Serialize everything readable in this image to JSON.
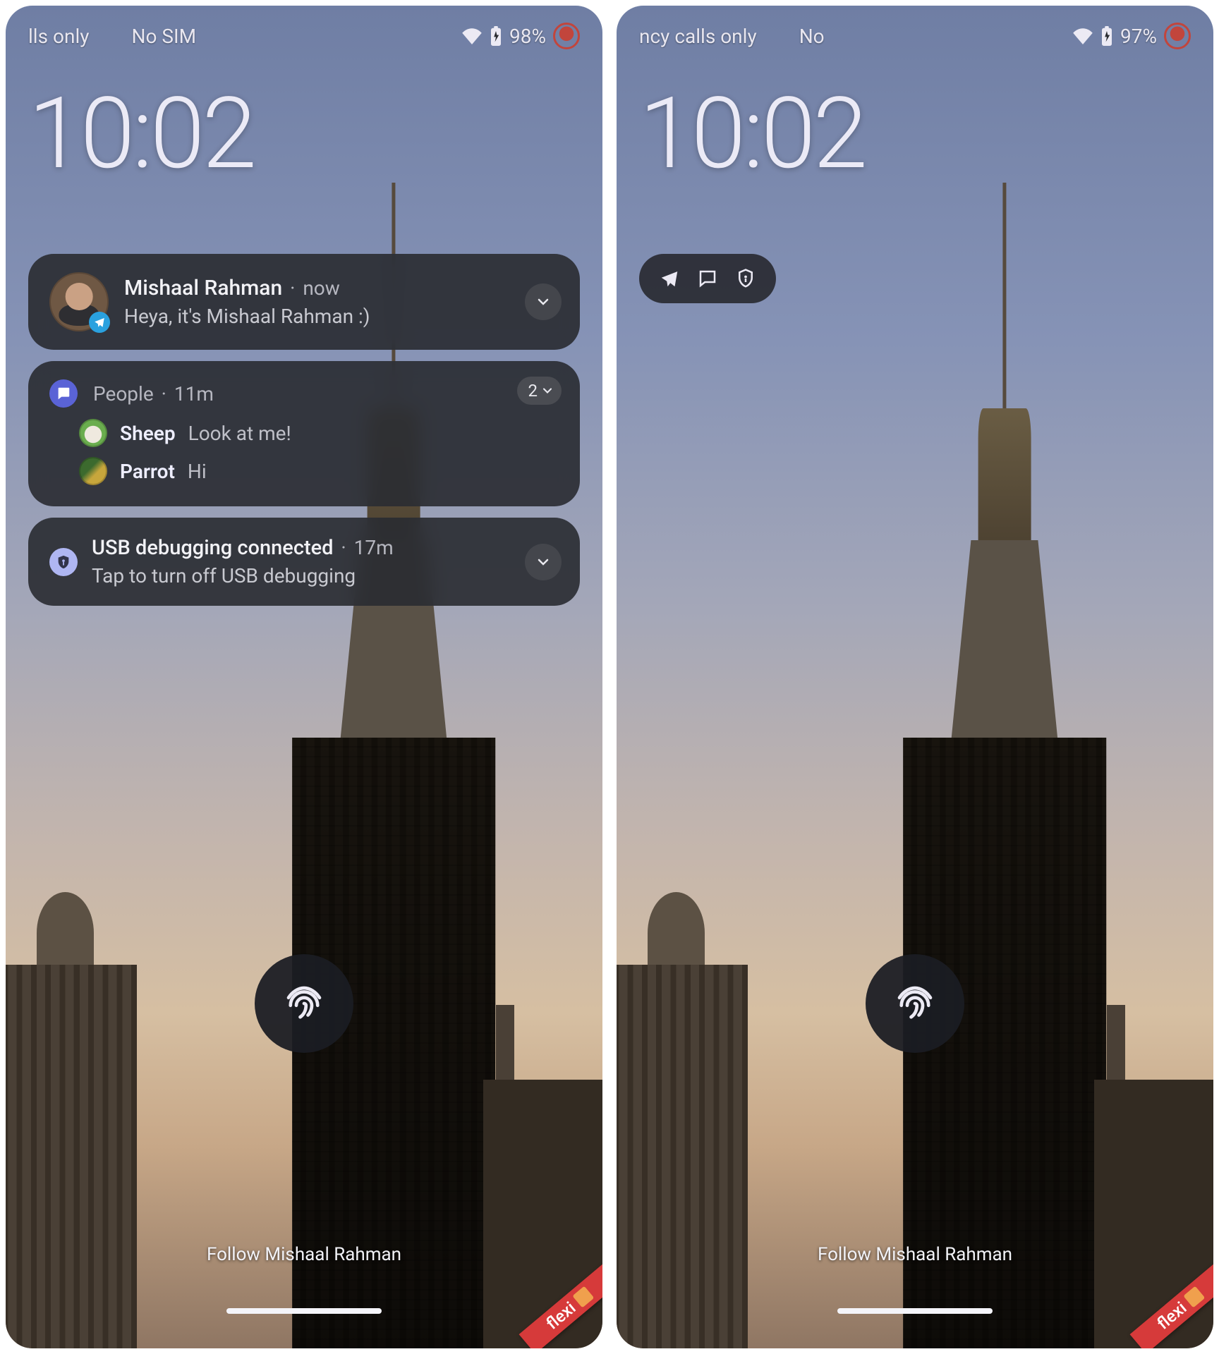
{
  "screens": {
    "left": {
      "status": {
        "carrier1": "lls only",
        "carrier2": "No SIM",
        "battery": "98%"
      },
      "clock": "10:02",
      "notifications": [
        {
          "kind": "telegram",
          "sender": "Mishaal Rahman",
          "time": "now",
          "body": "Heya, it's Mishaal Rahman :)"
        },
        {
          "kind": "people",
          "app": "People",
          "time": "11m",
          "count": "2",
          "conversations": [
            {
              "name": "Sheep",
              "msg": "Look at me!"
            },
            {
              "name": "Parrot",
              "msg": "Hi"
            }
          ]
        },
        {
          "kind": "usb",
          "title": "USB debugging connected",
          "time": "17m",
          "body": "Tap to turn off USB debugging"
        }
      ],
      "follow": "Follow Mishaal Rahman",
      "flexi": "flexi"
    },
    "right": {
      "status": {
        "carrier1": "ncy calls only",
        "carrier2": "No",
        "battery": "97%"
      },
      "clock": "10:02",
      "mini_icons": [
        "telegram",
        "chat",
        "shield"
      ],
      "follow": "Follow Mishaal Rahman",
      "flexi": "flexi"
    }
  },
  "separator": "·"
}
